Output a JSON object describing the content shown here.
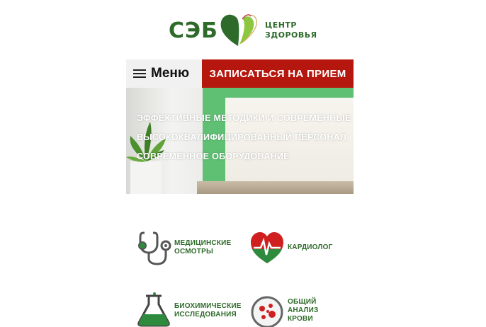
{
  "logo": {
    "abbr": "СЭБ",
    "line1": "ЦЕНТР",
    "line2": "ЗДОРОВЬЯ"
  },
  "nav": {
    "menu_label": "Меню",
    "cta_label": "ЗАПИСАТЬСЯ НА ПРИЕМ"
  },
  "hero": {
    "lines": [
      "ЭФФЕКТИВНЫЕ МЕТОДИКИ И СОВРЕМЕННЫЕ",
      "ВЫСОКОКВАЛИФИЦИРОВАННЫЙ ПЕРСОНАЛ",
      "СОВРЕМЕННОЕ ОБОРУДОВАНИЕ"
    ]
  },
  "services": [
    {
      "line1": "МЕДИЦИНСКИЕ",
      "line2": "ОСМОТРЫ",
      "line3": "",
      "icon": "stethoscope-icon"
    },
    {
      "line1": "КАРДИОЛОГ",
      "line2": "",
      "line3": "",
      "icon": "heart-pulse-icon"
    },
    {
      "line1": "БИОХИМИЧЕСКИЕ",
      "line2": "ИССЛЕДОВАНИЯ",
      "line3": "",
      "icon": "flask-icon"
    },
    {
      "line1": "ОБЩИЙ",
      "line2": "АНАЛИЗ",
      "line3": "КРОВИ",
      "icon": "blood-test-icon"
    }
  ],
  "colors": {
    "brand_green": "#2e6b2a",
    "cta_red": "#b5160d",
    "light_green": "#8dc63f"
  }
}
